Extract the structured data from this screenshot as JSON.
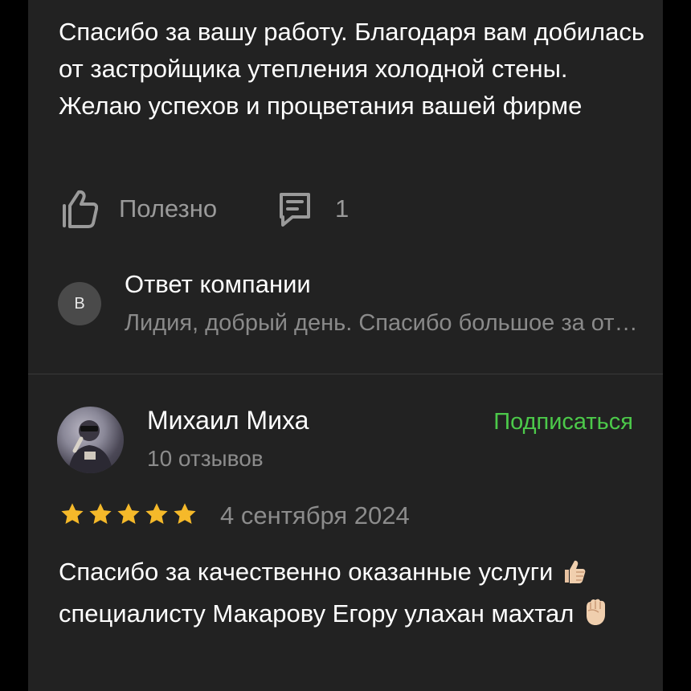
{
  "review1": {
    "text": "Спасибо за вашу работу. Благодаря вам добилась от застройщика утепления холодной стены. Желаю успехов и процветания вашей фирме",
    "helpful_label": "Полезно",
    "comments_count": "1",
    "company_reply": {
      "avatar_letter": "В",
      "title": "Ответ компании",
      "preview": "Лидия, добрый день. Спасибо большое за отзыв"
    }
  },
  "review2": {
    "author": {
      "name": "Михаил Миха",
      "reviews_count": "10 отзывов"
    },
    "subscribe_label": "Подписаться",
    "rating": 5,
    "date": "4 сентября 2024",
    "text_part1": "Спасибо за качественно оказанные услуги",
    "text_part2": "специалисту Макарову Егору улахан махтал"
  },
  "colors": {
    "background": "#222222",
    "accent_green": "#4cc94a",
    "star": "#f5b92a",
    "muted_text": "#8c8c8c"
  },
  "icons": [
    "thumbs-up-icon",
    "comment-icon",
    "star-icon",
    "thumbs-up-emoji-icon",
    "raised-fist-emoji-icon"
  ]
}
